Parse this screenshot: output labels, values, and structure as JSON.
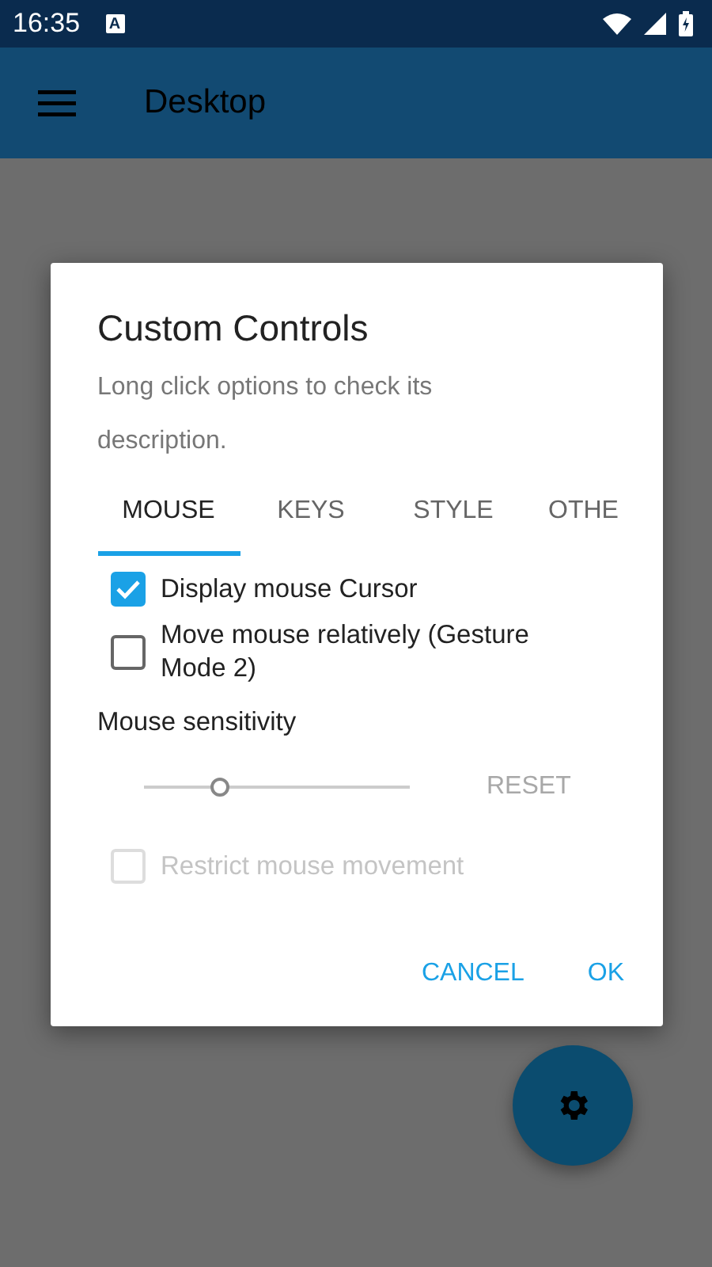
{
  "status_bar": {
    "time": "16:35",
    "notification": "A"
  },
  "app_bar": {
    "title": "Desktop"
  },
  "dialog": {
    "title": "Custom Controls",
    "description": "Long click options to check its description.",
    "tabs": [
      {
        "label": "MOUSE",
        "selected": true
      },
      {
        "label": "KEYS",
        "selected": false
      },
      {
        "label": "STYLE",
        "selected": false
      },
      {
        "label": "OTHE",
        "selected": false
      }
    ],
    "options": [
      {
        "kind": "checkbox",
        "label": "Display mouse Cursor",
        "checked": true,
        "disabled": false
      },
      {
        "kind": "checkbox",
        "label": "Move mouse relatively (Gesture Mode 2)",
        "checked": false,
        "disabled": false
      },
      {
        "kind": "heading",
        "label": "Mouse sensitivity"
      },
      {
        "kind": "slider",
        "level": 0.29,
        "disabled": true,
        "button": "RESET"
      },
      {
        "kind": "checkbox",
        "label": "Restrict mouse movement",
        "checked": false,
        "disabled": true
      }
    ],
    "buttons": [
      "CANCEL",
      "OK"
    ]
  }
}
